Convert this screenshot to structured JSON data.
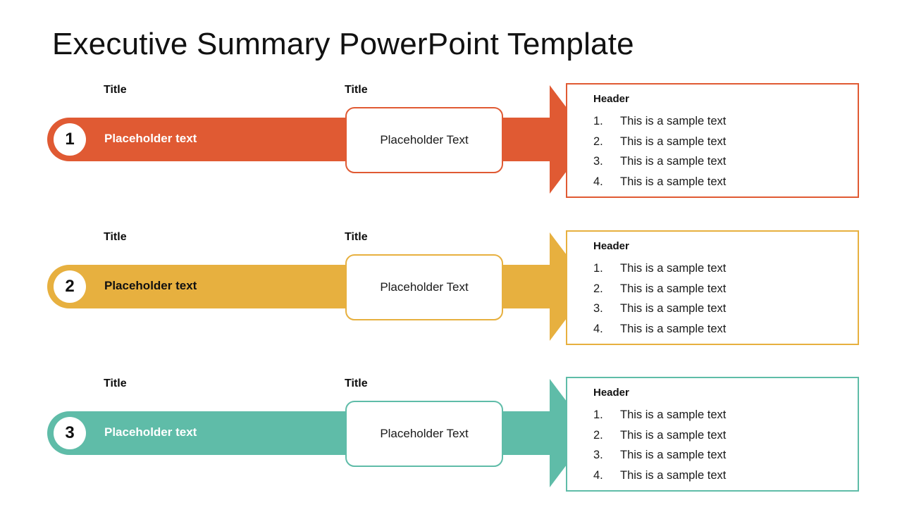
{
  "slide": {
    "title": "Executive Summary PowerPoint Template",
    "background": "#FFFFFF"
  },
  "colors": {
    "orange": "#E05A33",
    "amber": "#E7B03F",
    "teal": "#5FBCA8",
    "text_dark": "#111111",
    "text_white": "#FFFFFF"
  },
  "rows": [
    {
      "number": "1",
      "color": "#E05A33",
      "bar_text_color": "#FFFFFF",
      "caption_left": "Title",
      "caption_mid": "Title",
      "bar_label": "Placeholder text",
      "mid_box_label": "Placeholder Text",
      "panel": {
        "header": "Header",
        "items": [
          {
            "num": "1.",
            "text": "This is a sample text"
          },
          {
            "num": "2.",
            "text": "This is a sample text"
          },
          {
            "num": "3.",
            "text": "This is a sample text"
          },
          {
            "num": "4.",
            "text": "This is a sample text"
          }
        ]
      }
    },
    {
      "number": "2",
      "color": "#E7B03F",
      "bar_text_color": "#111111",
      "caption_left": "Title",
      "caption_mid": "Title",
      "bar_label": "Placeholder text",
      "mid_box_label": "Placeholder Text",
      "panel": {
        "header": "Header",
        "items": [
          {
            "num": "1.",
            "text": "This is a sample text"
          },
          {
            "num": "2.",
            "text": "This is a sample text"
          },
          {
            "num": "3.",
            "text": "This is a sample text"
          },
          {
            "num": "4.",
            "text": "This is a sample text"
          }
        ]
      }
    },
    {
      "number": "3",
      "color": "#5FBCA8",
      "bar_text_color": "#FFFFFF",
      "caption_left": "Title",
      "caption_mid": "Title",
      "bar_label": "Placeholder text",
      "mid_box_label": "Placeholder Text",
      "panel": {
        "header": "Header",
        "items": [
          {
            "num": "1.",
            "text": "This is a sample text"
          },
          {
            "num": "2.",
            "text": "This is a sample text"
          },
          {
            "num": "3.",
            "text": "This is a sample text"
          },
          {
            "num": "4.",
            "text": "This is a sample text"
          }
        ]
      }
    }
  ]
}
